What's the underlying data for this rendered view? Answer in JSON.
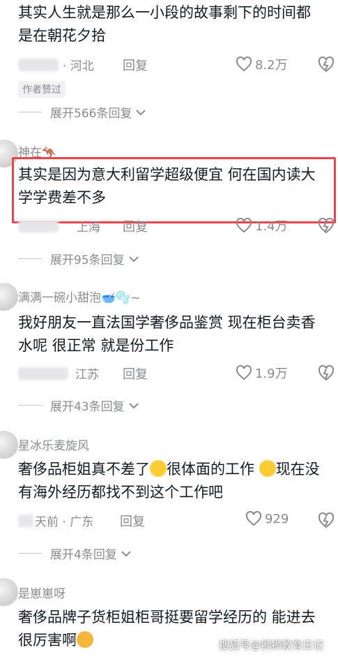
{
  "comments": [
    {
      "text": "其实人生就是那么一小段的故事剩下的时间都是在朝花夕拾",
      "location": "· 河北",
      "reply": "回复",
      "likes": "8.2万",
      "badge": "作者赞过",
      "expand": "展开566条回复"
    },
    {
      "username": "神在🦘",
      "text": "其实是因为意大利留学超级便宜 何在国内读大学学费差不多",
      "location": "上海",
      "reply": "回复",
      "likes": "1.4万",
      "expand": "展开95条回复"
    },
    {
      "username": "满满一碗小甜泡🥣🫧~",
      "text": "我好朋友一直法国学奢侈品鉴赏  现在柜台卖香水呢  很正常  就是份工作",
      "location": "江苏",
      "reply": "回复",
      "likes": "1.9万",
      "expand": "展开43条回复"
    },
    {
      "username": "星冰乐麦旋风",
      "text_part1": "奢侈品柜姐真不差了",
      "text_part2": "很体面的工作 ",
      "text_part3": "现在没有海外经历都找不到这个工作吧",
      "location": "天前 · 广东",
      "reply": "回复",
      "likes": "929",
      "expand": "展开4条回复"
    },
    {
      "username": "是崽崽呀",
      "text": "奢侈品牌子货柜姐柜哥挺要留学经历的 能进去很厉害啊"
    }
  ],
  "watermark": "搜狐号@狮狮教育日记",
  "colors": {
    "highlight": "#f0424b",
    "meta": "#8a8b91",
    "text": "#161823"
  }
}
